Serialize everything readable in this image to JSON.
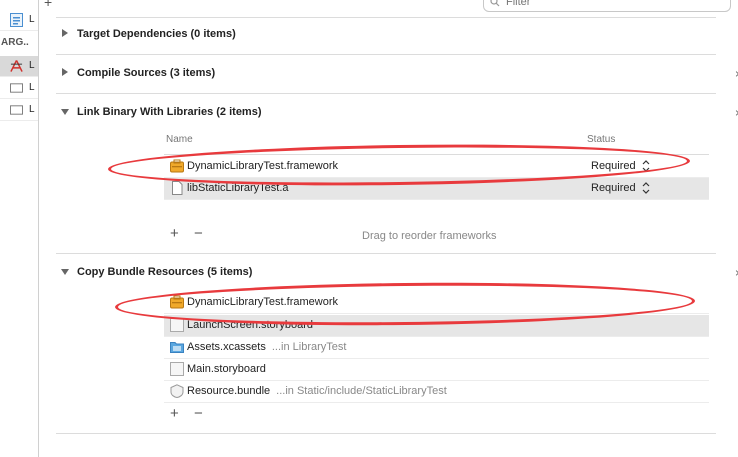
{
  "navigator": {
    "items": [
      {
        "label": "L",
        "icon": "swift-file-icon"
      },
      {
        "label": "ARG..",
        "icon": "group-label"
      },
      {
        "label": "L",
        "icon": "app-target-icon"
      },
      {
        "label": "L",
        "icon": "library-target-icon"
      },
      {
        "label": "L",
        "icon": "library-target-icon"
      }
    ]
  },
  "toolbar": {
    "add_label": "+",
    "filter_placeholder": "Filter"
  },
  "phases": {
    "target_dependencies": {
      "title": "Target Dependencies (0 items)"
    },
    "compile_sources": {
      "title": "Compile Sources (3 items)",
      "close": "×"
    },
    "link_binary": {
      "title": "Link Binary With Libraries (2 items)",
      "close": "×",
      "col_name": "Name",
      "col_status": "Status",
      "rows": [
        {
          "name": "DynamicLibraryTest.framework",
          "status": "Required",
          "icon": "framework-icon"
        },
        {
          "name": "libStaticLibraryTest.a",
          "status": "Required",
          "icon": "document-icon"
        }
      ],
      "add": "+",
      "remove": "−",
      "hint": "Drag to reorder frameworks"
    },
    "copy_bundle": {
      "title": "Copy Bundle Resources (5 items)",
      "close": "×",
      "rows": [
        {
          "name": "DynamicLibraryTest.framework",
          "path": "",
          "icon": "framework-icon"
        },
        {
          "name": "LaunchScreen.storyboard",
          "path": "",
          "icon": "storyboard-icon"
        },
        {
          "name": "Assets.xcassets",
          "path": "...in LibraryTest",
          "icon": "folder-icon"
        },
        {
          "name": "Main.storyboard",
          "path": "",
          "icon": "storyboard-icon"
        },
        {
          "name": "Resource.bundle",
          "path": "...in Static/include/StaticLibraryTest",
          "icon": "bundle-icon"
        }
      ],
      "add": "+",
      "remove": "−"
    }
  },
  "colors": {
    "annotation": "#e83a3d",
    "framework_icon": "#f0a92a",
    "folder_icon": "#5aa7e0"
  }
}
